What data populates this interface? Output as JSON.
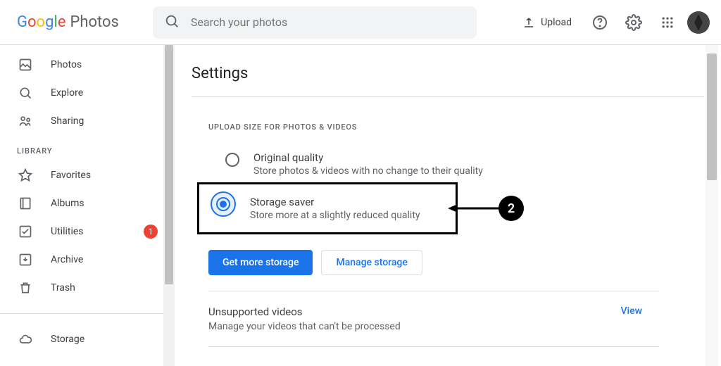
{
  "header": {
    "product": "Photos",
    "search_placeholder": "Search your photos",
    "upload_label": "Upload"
  },
  "sidebar": {
    "items": [
      {
        "label": "Photos"
      },
      {
        "label": "Explore"
      },
      {
        "label": "Sharing"
      }
    ],
    "library_head": "LIBRARY",
    "library": [
      {
        "label": "Favorites"
      },
      {
        "label": "Albums"
      },
      {
        "label": "Utilities",
        "badge": "1"
      },
      {
        "label": "Archive"
      },
      {
        "label": "Trash"
      }
    ],
    "storage_label": "Storage"
  },
  "settings": {
    "title": "Settings",
    "upload_section_head": "UPLOAD SIZE FOR PHOTOS & VIDEOS",
    "options": [
      {
        "title": "Original quality",
        "sub": "Store photos & videos with no change to their quality"
      },
      {
        "title": "Storage saver",
        "sub": "Store more at a slightly reduced quality"
      }
    ],
    "get_more": "Get more storage",
    "manage": "Manage storage",
    "unsupported": {
      "title": "Unsupported videos",
      "sub": "Manage your videos that can't be processed",
      "action": "View"
    }
  },
  "annotation": {
    "step": "2"
  }
}
